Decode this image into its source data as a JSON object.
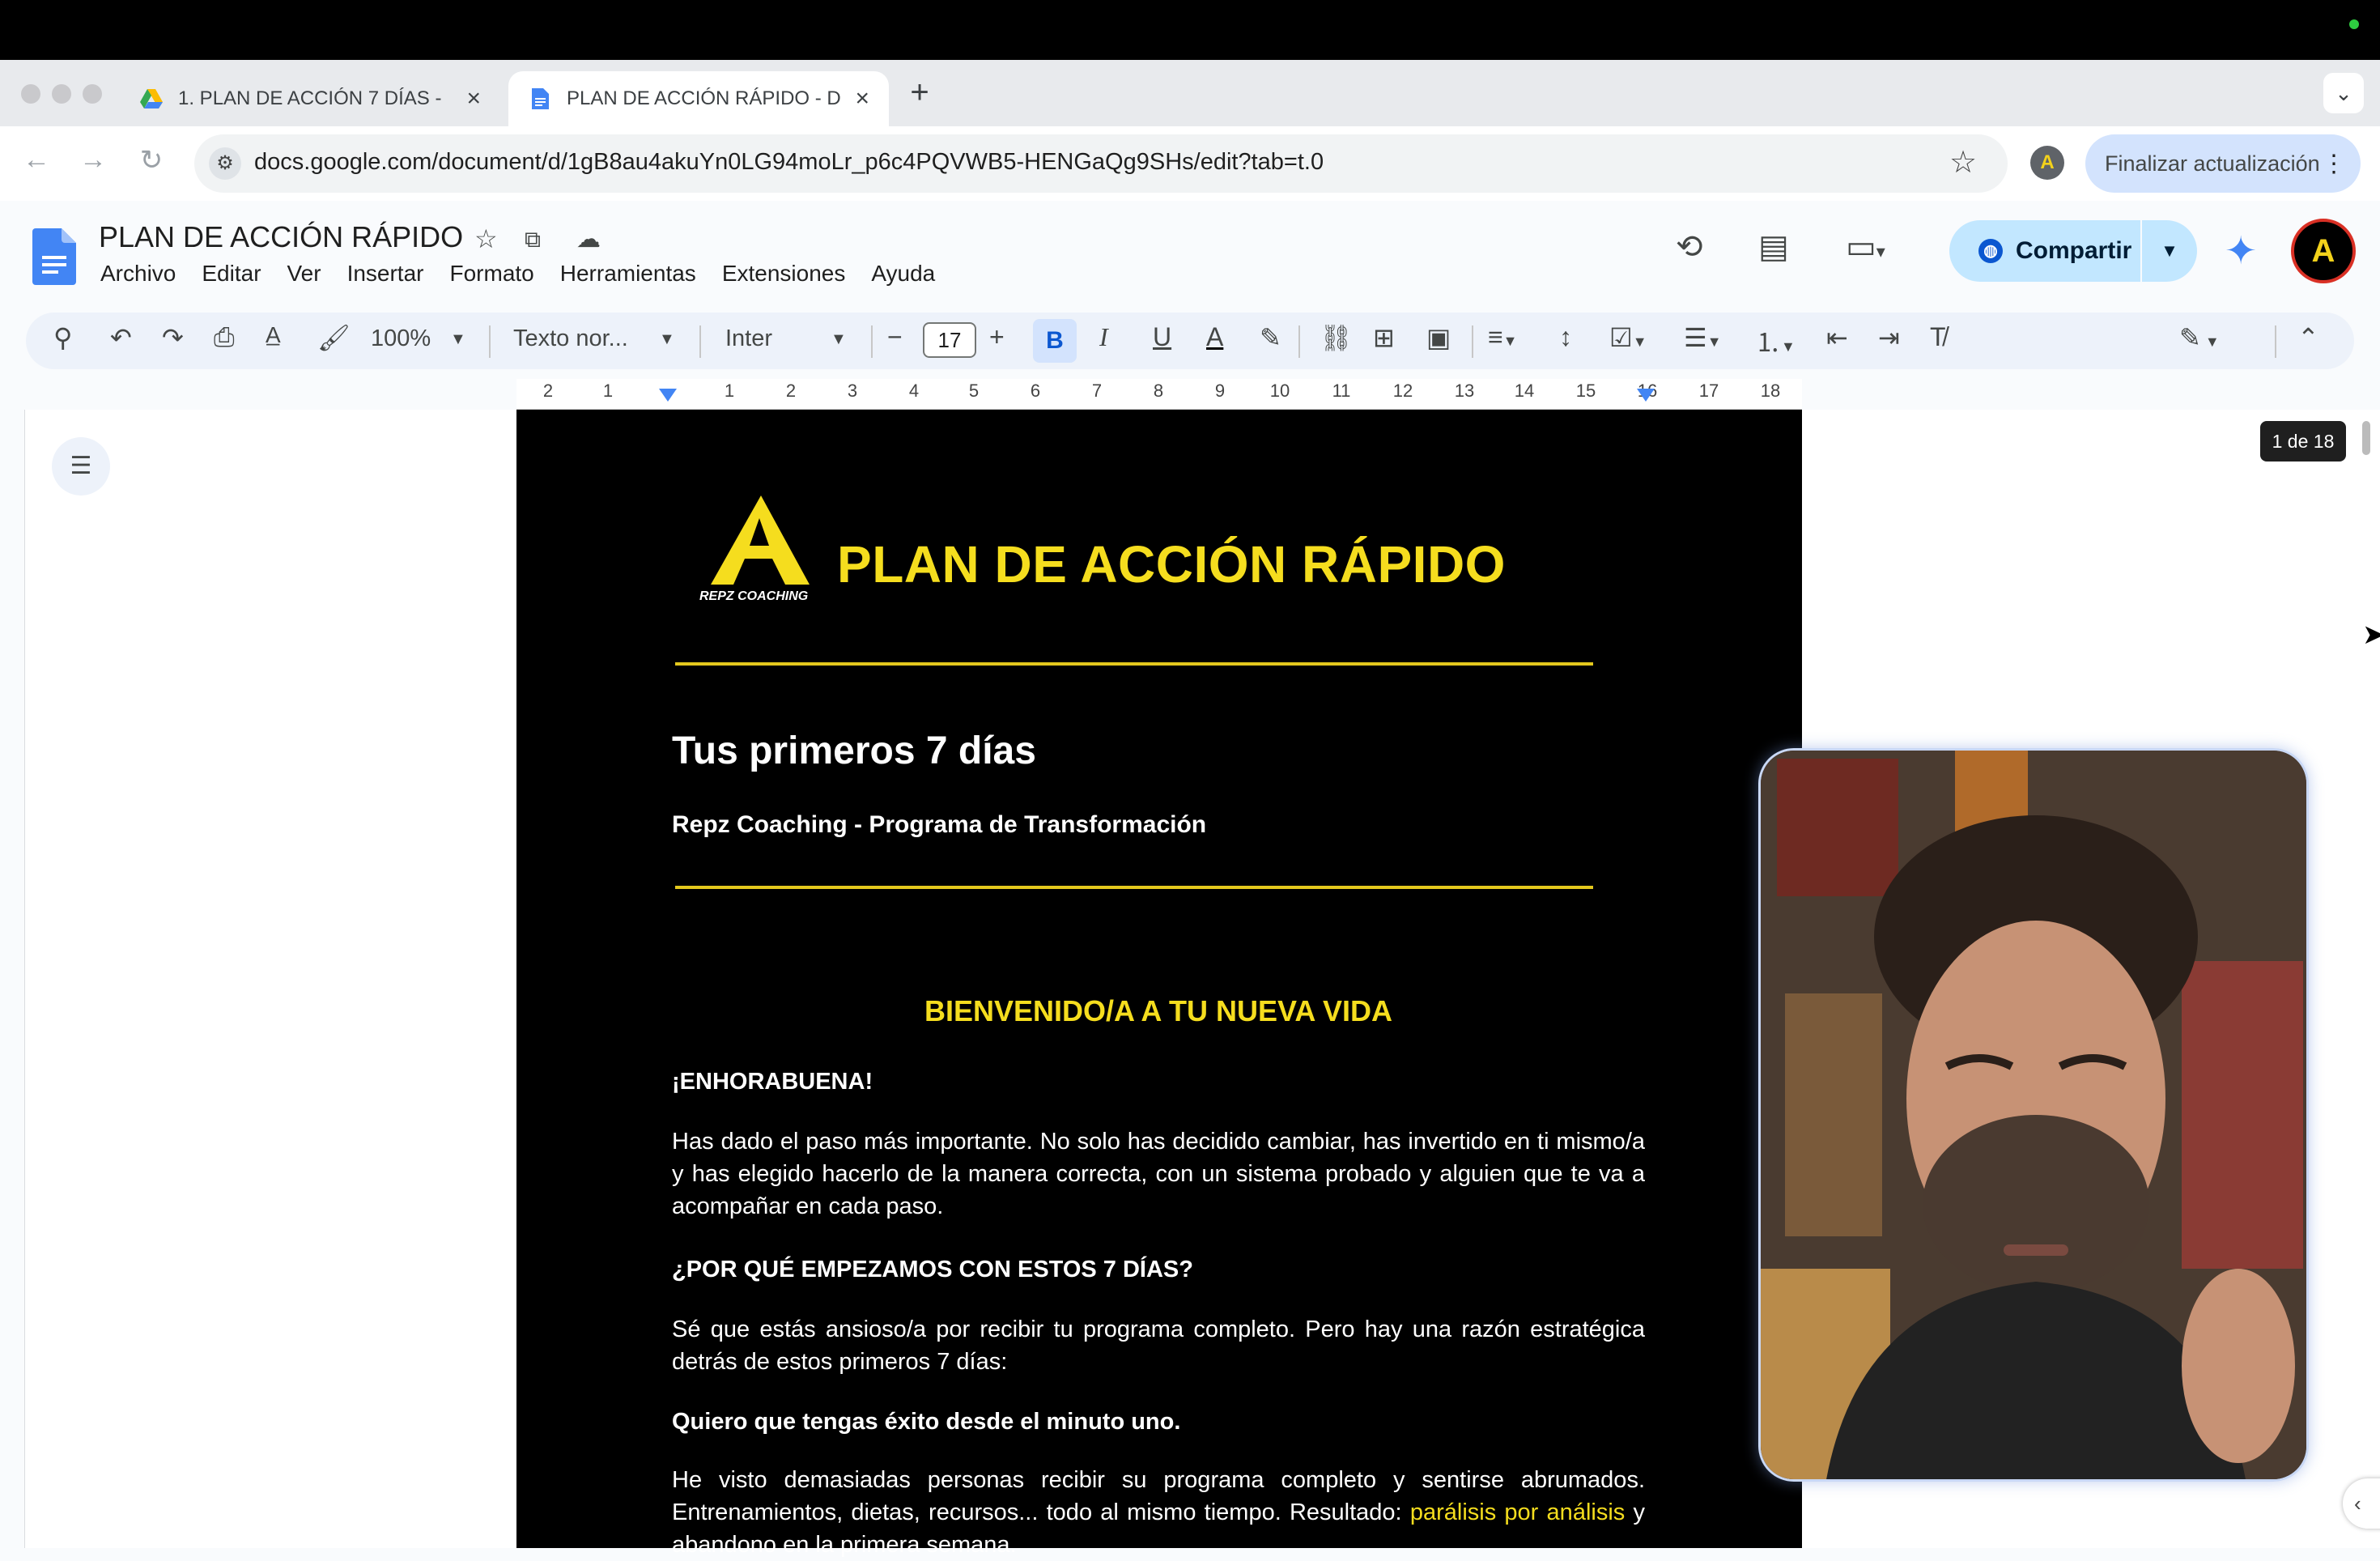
{
  "browser": {
    "tabs": [
      {
        "label": "1. PLAN DE ACCIÓN 7 DÍAS -",
        "active": false
      },
      {
        "label": "PLAN DE ACCIÓN RÁPIDO - D",
        "active": true
      }
    ],
    "new_tab": "+",
    "tab_list": "⌄",
    "url": "docs.google.com/document/d/1gB8au4akuYn0LG94moLr_p6c4PQVWB5-HENGaQg9SHs/edit?tab=t.0",
    "update_button": "Finalizar actualización"
  },
  "docs": {
    "title": "PLAN DE ACCIÓN RÁPIDO",
    "menu": [
      "Archivo",
      "Editar",
      "Ver",
      "Insertar",
      "Formato",
      "Herramientas",
      "Extensiones",
      "Ayuda"
    ],
    "share_label": "Compartir",
    "toolbar": {
      "zoom": "100%",
      "style": "Texto nor...",
      "font": "Inter",
      "font_size": "17"
    },
    "ruler_numbers": [
      "2",
      "1",
      "1",
      "2",
      "3",
      "4",
      "5",
      "6",
      "7",
      "8",
      "9",
      "10",
      "11",
      "12",
      "13",
      "14",
      "15",
      "16",
      "17",
      "18"
    ],
    "page_indicator": "1 de 18"
  },
  "document": {
    "logo_caption": "REPZ COACHING",
    "heading": "PLAN DE ACCIÓN RÁPIDO",
    "subtitle": "Tus primeros 7 días",
    "program": "Repz Coaching - Programa de Transformación",
    "welcome": "BIENVENIDO/A A TU NUEVA VIDA",
    "congrats": "¡ENHORABUENA!",
    "para1": "Has dado el paso más importante. No solo has decidido cambiar, has invertido en ti mismo/a y has elegido hacerlo de la manera correcta, con un sistema probado y alguien que te va a acompañar en cada paso.",
    "why_heading": "¿POR QUÉ EMPEZAMOS CON ESTOS 7 DÍAS?",
    "para2": "Sé que estás ansioso/a por recibir tu programa completo. Pero hay una razón estratégica detrás de estos primeros 7 días:",
    "success_line": "Quiero que tengas éxito desde el minuto uno.",
    "para3_start": "He visto demasiadas personas recibir su programa completo y sentirse abrumados. Entrenamientos, dietas, recursos... todo al mismo tiempo. Resultado: ",
    "para3_highlight": "parálisis por análisis",
    "para3_end": " y abandono en la primera semana."
  },
  "colors": {
    "accent_yellow": "#f5dd1e",
    "share_bg": "#c2e7ff",
    "page_bg": "#000000"
  },
  "icons": [
    "docs-logo-icon",
    "star-icon",
    "move-folder-icon",
    "cloud-status-icon",
    "history-icon",
    "comment-icon",
    "meet-icon",
    "gemini-icon",
    "search-icon",
    "undo-icon",
    "redo-icon",
    "print-icon",
    "spellcheck-icon",
    "paint-format-icon",
    "outline-icon"
  ]
}
